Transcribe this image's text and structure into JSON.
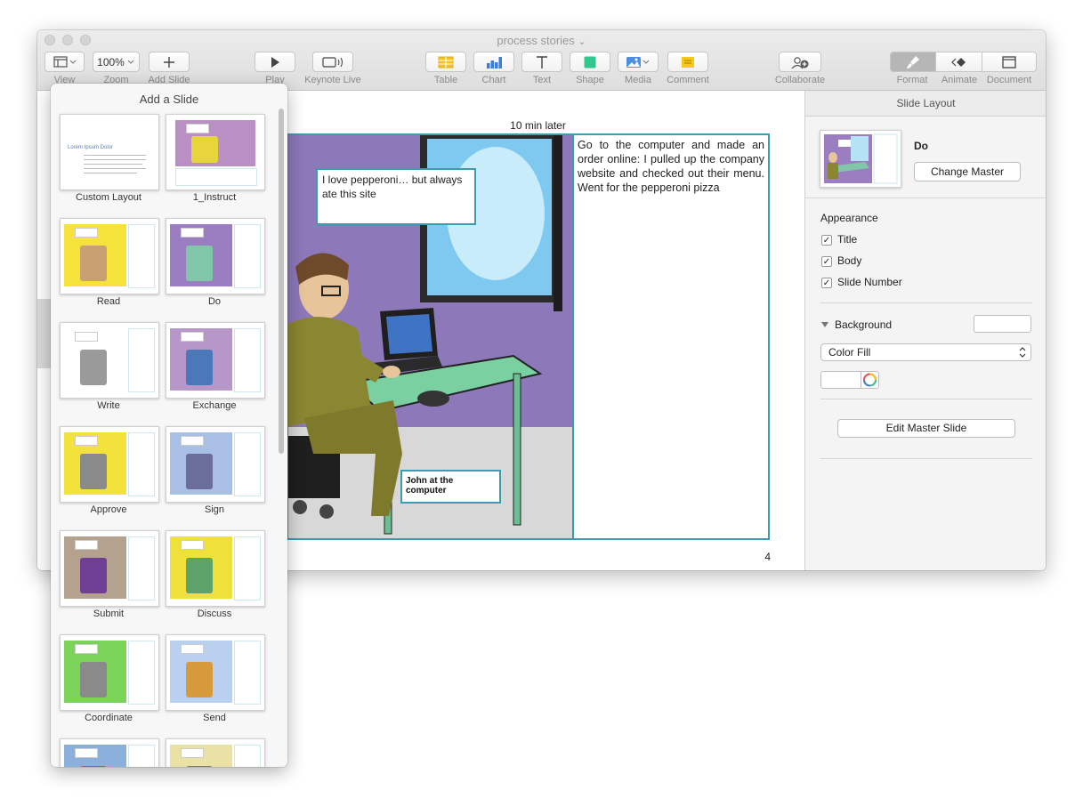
{
  "window": {
    "title": "process stories",
    "title_chevron": "⌄"
  },
  "toolbar": {
    "view_label": "View",
    "zoom_value": "100%",
    "zoom_label": "Zoom",
    "add_slide_label": "Add Slide",
    "play_label": "Play",
    "keynote_live_label": "Keynote Live",
    "table_label": "Table",
    "chart_label": "Chart",
    "text_label": "Text",
    "shape_label": "Shape",
    "media_label": "Media",
    "comment_label": "Comment",
    "collaborate_label": "Collaborate",
    "format_label": "Format",
    "animate_label": "Animate",
    "document_label": "Document"
  },
  "slide": {
    "header_text": "10 min later",
    "speech_bubble": "I love pepperoni… but always ate this site",
    "caption": "John at the computer",
    "body_text": "Go to the computer and made an order online: I pulled up the company website and checked out their menu. Went for the pepperoni pizza",
    "slide_number": "4"
  },
  "popover": {
    "title": "Add a Slide",
    "custom_layout_thumb_title": "Lorem Ipsum Dolor",
    "layouts": [
      {
        "label": "Custom Layout",
        "bg": "#ffffff",
        "figure": "#ffffff"
      },
      {
        "label": "1_Instruct",
        "bg": "#b98fc4",
        "figure": "#e8d53c"
      },
      {
        "label": "Read",
        "bg": "#f5e23a",
        "figure": "#c9a071"
      },
      {
        "label": "Do",
        "bg": "#9b7ec1",
        "figure": "#7fc7a8"
      },
      {
        "label": "Write",
        "bg": "#ffffff",
        "figure": "#9a9a9a"
      },
      {
        "label": "Exchange",
        "bg": "#b797c8",
        "figure": "#4b78b8"
      },
      {
        "label": "Approve",
        "bg": "#f3e23b",
        "figure": "#8a8a8a"
      },
      {
        "label": "Sign",
        "bg": "#a9bfe3",
        "figure": "#6d6d9c"
      },
      {
        "label": "Submit",
        "bg": "#b5a28e",
        "figure": "#6e3f93"
      },
      {
        "label": "Discuss",
        "bg": "#f0e13a",
        "figure": "#5ea36c"
      },
      {
        "label": "Coordinate",
        "bg": "#7bd35a",
        "figure": "#8a8a8a"
      },
      {
        "label": "Send",
        "bg": "#b9d1ef",
        "figure": "#d69a3c"
      },
      {
        "label": "",
        "bg": "#8cb0dc",
        "figure": "#c05050"
      },
      {
        "label": "",
        "bg": "#e9e2a4",
        "figure": "#777777"
      }
    ]
  },
  "inspector": {
    "header": "Slide Layout",
    "layout_name": "Do",
    "change_master_label": "Change Master",
    "appearance_label": "Appearance",
    "title_label": "Title",
    "body_label": "Body",
    "slide_number_label": "Slide Number",
    "title_checked": true,
    "body_checked": true,
    "slide_number_checked": true,
    "background_label": "Background",
    "fill_value": "Color Fill",
    "edit_master_label": "Edit Master Slide",
    "check_glyph": "✓"
  },
  "colors": {
    "accent_border": "#3d9bb0",
    "format_active": "#b6b6b6"
  }
}
